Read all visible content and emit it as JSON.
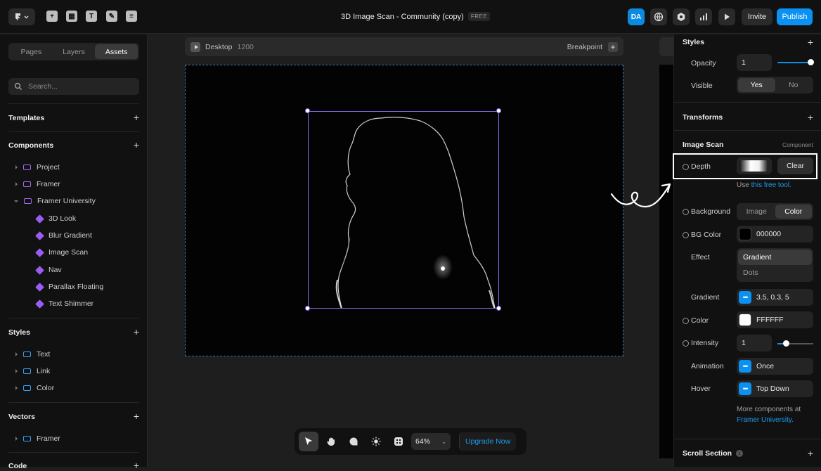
{
  "topbar": {
    "title": "3D Image Scan - Community (copy)",
    "plan_badge": "FREE",
    "avatar_initials": "DA",
    "invite_label": "Invite",
    "publish_label": "Publish"
  },
  "left": {
    "tabs": [
      "Pages",
      "Layers",
      "Assets"
    ],
    "search_placeholder": "Search...",
    "templates": "Templates",
    "components": "Components",
    "component_items": [
      "Project",
      "Framer",
      "Framer University",
      "3D Look",
      "Blur Gradient",
      "Image Scan",
      "Nav",
      "Parallax Floating",
      "Text Shimmer"
    ],
    "styles": "Styles",
    "style_items": [
      "Text",
      "Link",
      "Color"
    ],
    "vectors": "Vectors",
    "vector_items": [
      "Framer"
    ],
    "code": "Code"
  },
  "canvas": {
    "breakpoint_name": "Desktop",
    "breakpoint_width": "1200",
    "breakpoint_label": "Breakpoint"
  },
  "toolbar": {
    "zoom": "64%",
    "upgrade": "Upgrade Now"
  },
  "right": {
    "styles": "Styles",
    "opacity_label": "Opacity",
    "opacity_value": "1",
    "visible_label": "Visible",
    "visible_yes": "Yes",
    "visible_no": "No",
    "transforms": "Transforms",
    "image_scan": "Image Scan",
    "component_tag": "Component",
    "depth_label": "Depth",
    "clear_label": "Clear",
    "hint_prefix": "Use ",
    "hint_link": "this free tool.",
    "background_label": "Background",
    "bg_image": "Image",
    "bg_color": "Color",
    "bgcolor_label": "BG Color",
    "bgcolor_value": "000000",
    "effect_label": "Effect",
    "effect_gradient": "Gradient",
    "effect_dots": "Dots",
    "gradient_label": "Gradient",
    "gradient_value": "3.5, 0.3, 5",
    "color_label": "Color",
    "color_value": "FFFFFF",
    "intensity_label": "Intensity",
    "intensity_value": "1",
    "animation_label": "Animation",
    "animation_value": "Once",
    "hover_label": "Hover",
    "hover_value": "Top Down",
    "more_text": "More components at",
    "more_link": "Framer University.",
    "scroll_section": "Scroll Section"
  }
}
